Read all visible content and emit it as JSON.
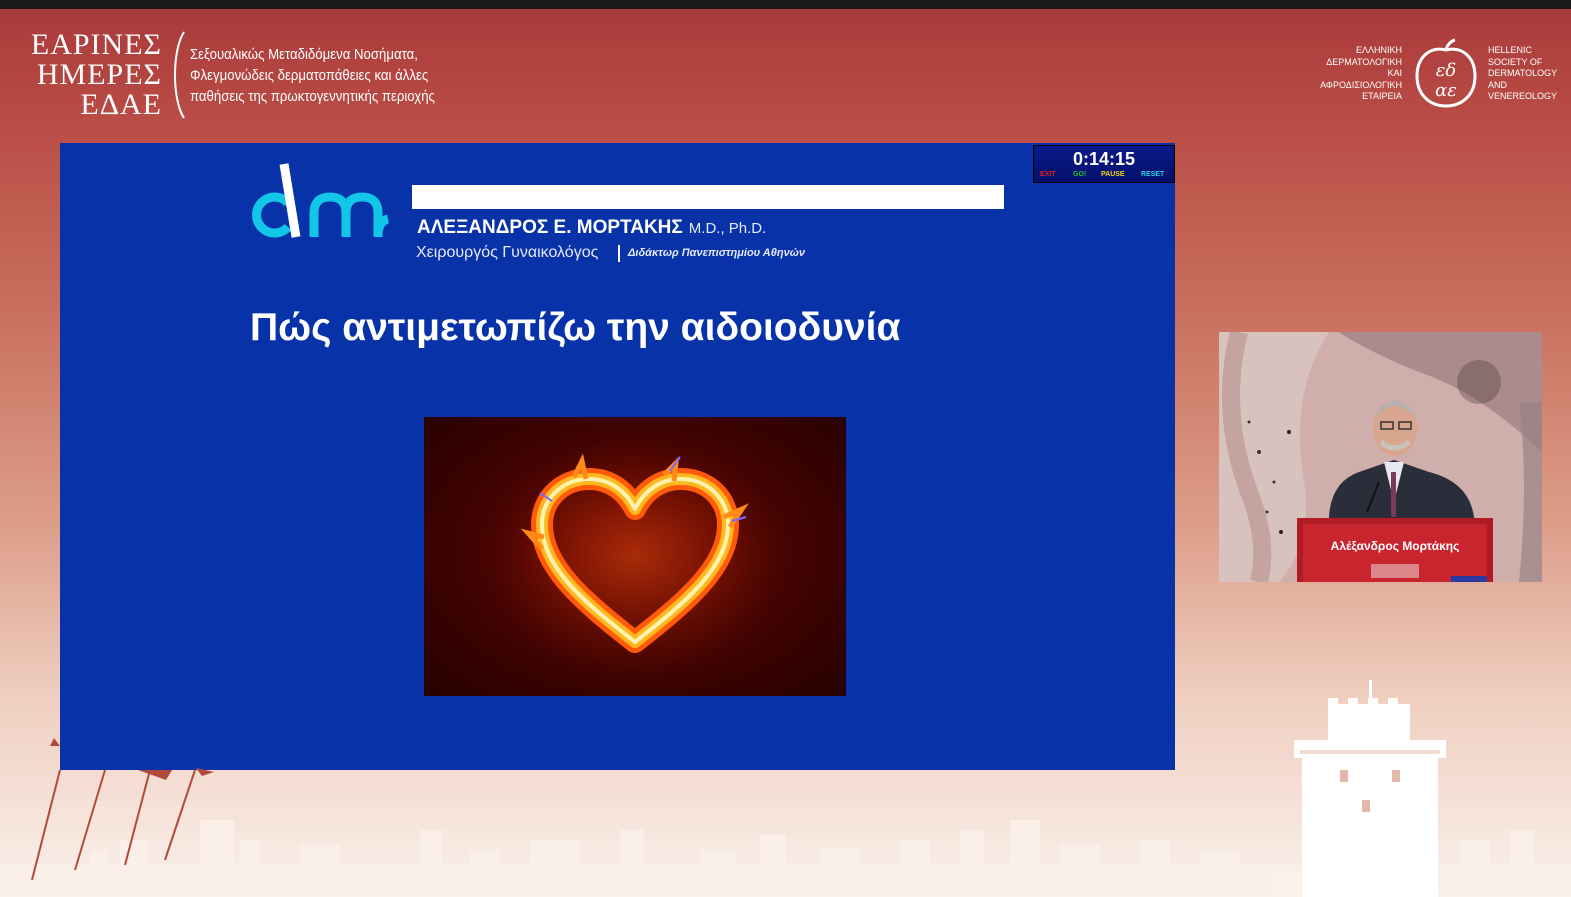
{
  "event": {
    "title_lines": [
      "ΕΑΡΙΝΕΣ",
      "ΗΜΕΡΕΣ",
      "ΕΔΑΕ"
    ],
    "subtitle_lines": [
      "Σεξουαλικώς Μεταδιδόμενα Νοσήματα,",
      "Φλεγμονώδεις δερματοπάθειες και άλλες",
      "παθήσεις της πρωκτογεννητικής περιοχής"
    ]
  },
  "society": {
    "greek_lines": [
      "ΕΛΛΗΝΙΚΗ",
      "ΔΕΡΜΑΤΟΛΟΓΙΚΗ",
      "ΚΑΙ",
      "ΑΦΡΟΔΙΣΙΟΛΟΓΙΚΗ",
      "ΕΤΑΙΡΕΙΑ"
    ],
    "english_lines": [
      "HELLENIC",
      "SOCIETY OF",
      "DERMATOLOGY",
      "AND",
      "VENEREOLOGY"
    ],
    "mark_icon": "edae-logo-icon"
  },
  "slide": {
    "doctor_name": "ΑΛΕΞΑΝΔΡΟΣ Ε. ΜΟΡΤΑΚΗΣ",
    "degrees": "M.D., Ph.D.",
    "role": "Χειρουργός Γυναικολόγος",
    "university": "Διδάκτωρ Πανεπιστημίου Αθηνών",
    "title": "Πώς αντιμετωπίζω την αιδοιοδυνία",
    "logo_icon": "dm-logo-icon",
    "image_icon": "flaming-heart-icon",
    "bg_color": "#0732a8"
  },
  "timer": {
    "time": "0:14:15",
    "buttons": [
      {
        "label": "EXIT",
        "color": "#e0201a"
      },
      {
        "label": "GO!",
        "color": "#22c02a"
      },
      {
        "label": "PAUSE",
        "color": "#f2d21a"
      },
      {
        "label": "RESET",
        "color": "#29d3e8"
      }
    ]
  },
  "speaker": {
    "podium_label": "Αλέξανδρος Μορτάκης"
  },
  "colors": {
    "accent": "#a8393a",
    "logo_cyan": "#12c6e8"
  }
}
